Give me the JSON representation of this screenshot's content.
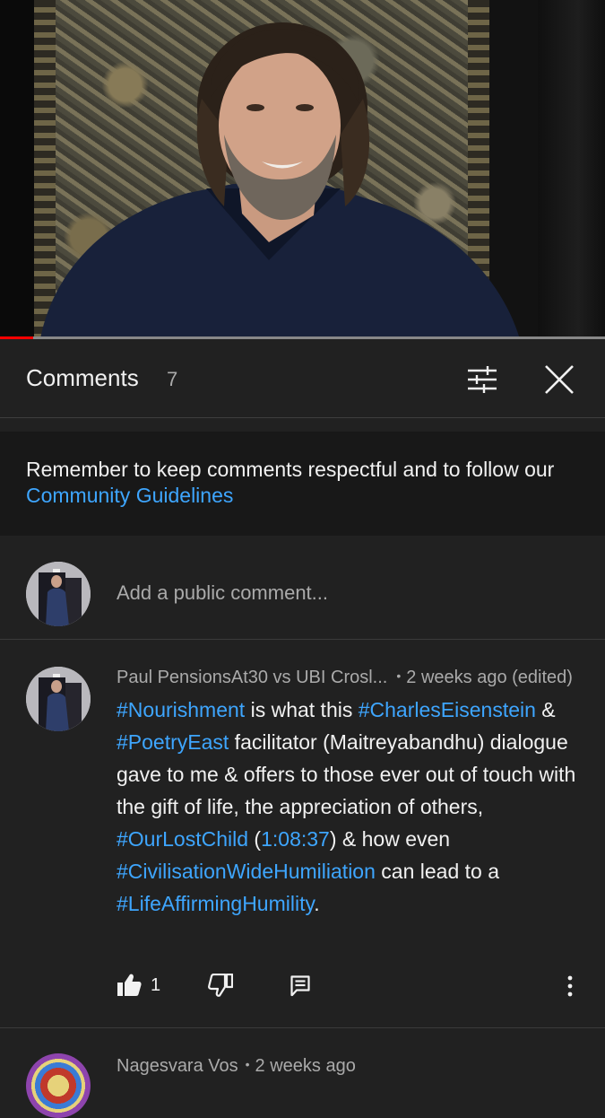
{
  "video": {
    "progress_fraction": 0.055,
    "progress_color": "#ff0000"
  },
  "comments_panel": {
    "title": "Comments",
    "count": "7",
    "icons": [
      "filter-icon",
      "close-icon"
    ]
  },
  "notice": {
    "text_before_link": "Remember to keep comments respectful and to follow our ",
    "link_text": "Community Guidelines",
    "link_color": "#3ea6ff"
  },
  "add_comment": {
    "placeholder": "Add a public comment..."
  },
  "comment_1": {
    "author": "Paul PensionsAt30 vs UBI Crosl...",
    "separator": "•",
    "time": "2 weeks ago (edited)",
    "body": [
      {
        "text": "#Nourishment",
        "link": true
      },
      {
        "text": " is what this ",
        "link": false
      },
      {
        "text": "#CharlesEisenstein",
        "link": true
      },
      {
        "text": " & ",
        "link": false
      },
      {
        "text": "#PoetryEast",
        "link": true
      },
      {
        "text": " facilitator (Maitreyabandhu) dialogue gave to me & offers to those ever out of touch with the gift of life, the appreciation of others, ",
        "link": false
      },
      {
        "text": "#OurLostChild",
        "link": true
      },
      {
        "text": " (",
        "link": false
      },
      {
        "text": "1:08:37",
        "link": true
      },
      {
        "text": ") & how even ",
        "link": false
      },
      {
        "text": "#CivilisationWideHumiliation",
        "link": true
      },
      {
        "text": " can lead to a ",
        "link": false
      },
      {
        "text": "#LifeAffirmingHumility",
        "link": true
      },
      {
        "text": ".",
        "link": false
      }
    ],
    "like_count": "1",
    "icons": [
      "thumbs-up-icon",
      "thumbs-down-icon",
      "reply-icon",
      "more-vert-icon"
    ]
  },
  "comment_2": {
    "author": "Nagesvara Vos",
    "separator": "•",
    "time": "2 weeks ago"
  }
}
